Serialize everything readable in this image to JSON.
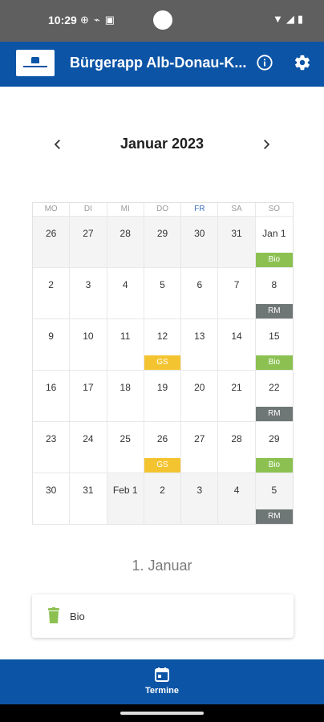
{
  "status_bar": {
    "time": "10:29",
    "left_icons": [
      "⊕",
      "⌁",
      "▣"
    ],
    "right_icons": [
      "▼",
      "◢",
      "▮"
    ]
  },
  "app_bar": {
    "title": "Bürgerapp Alb-Donau-K...",
    "info_icon": "info-icon",
    "settings_icon": "gear-icon"
  },
  "calendar": {
    "month_title": "Januar 2023",
    "weekdays": [
      "MO",
      "DI",
      "MI",
      "DO",
      "FR",
      "SA",
      "SO"
    ],
    "weeks": [
      [
        {
          "label": "26",
          "outside": true
        },
        {
          "label": "27",
          "outside": true
        },
        {
          "label": "28",
          "outside": true
        },
        {
          "label": "29",
          "outside": true
        },
        {
          "label": "30",
          "outside": true
        },
        {
          "label": "31",
          "outside": true
        },
        {
          "label": "Jan 1",
          "event": "Bio",
          "kind": "bio"
        }
      ],
      [
        {
          "label": "2"
        },
        {
          "label": "3"
        },
        {
          "label": "4"
        },
        {
          "label": "5"
        },
        {
          "label": "6"
        },
        {
          "label": "7"
        },
        {
          "label": "8",
          "event": "RM",
          "kind": "rm"
        }
      ],
      [
        {
          "label": "9"
        },
        {
          "label": "10"
        },
        {
          "label": "11"
        },
        {
          "label": "12",
          "event": "GS",
          "kind": "gs"
        },
        {
          "label": "13"
        },
        {
          "label": "14"
        },
        {
          "label": "15",
          "event": "Bio",
          "kind": "bio"
        }
      ],
      [
        {
          "label": "16"
        },
        {
          "label": "17"
        },
        {
          "label": "18"
        },
        {
          "label": "19"
        },
        {
          "label": "20"
        },
        {
          "label": "21"
        },
        {
          "label": "22",
          "event": "RM",
          "kind": "rm"
        }
      ],
      [
        {
          "label": "23"
        },
        {
          "label": "24"
        },
        {
          "label": "25"
        },
        {
          "label": "26",
          "event": "GS",
          "kind": "gs"
        },
        {
          "label": "27"
        },
        {
          "label": "28"
        },
        {
          "label": "29",
          "event": "Bio",
          "kind": "bio"
        }
      ],
      [
        {
          "label": "30"
        },
        {
          "label": "31"
        },
        {
          "label": "Feb 1",
          "outside": true
        },
        {
          "label": "2",
          "outside": true
        },
        {
          "label": "3",
          "outside": true
        },
        {
          "label": "4",
          "outside": true
        },
        {
          "label": "5",
          "outside": true,
          "event": "RM",
          "kind": "rm"
        }
      ]
    ]
  },
  "selected": {
    "date_label": "1. Januar",
    "events": [
      {
        "label": "Bio",
        "icon": "trash-icon",
        "color": "#8cc152"
      }
    ]
  },
  "bottom_nav": {
    "tab_label": "Termine",
    "tab_icon": "calendar-icon"
  },
  "colors": {
    "primary": "#0b54a6",
    "bio": "#8cc152",
    "rm": "#6f7676",
    "gs": "#f4c430"
  }
}
